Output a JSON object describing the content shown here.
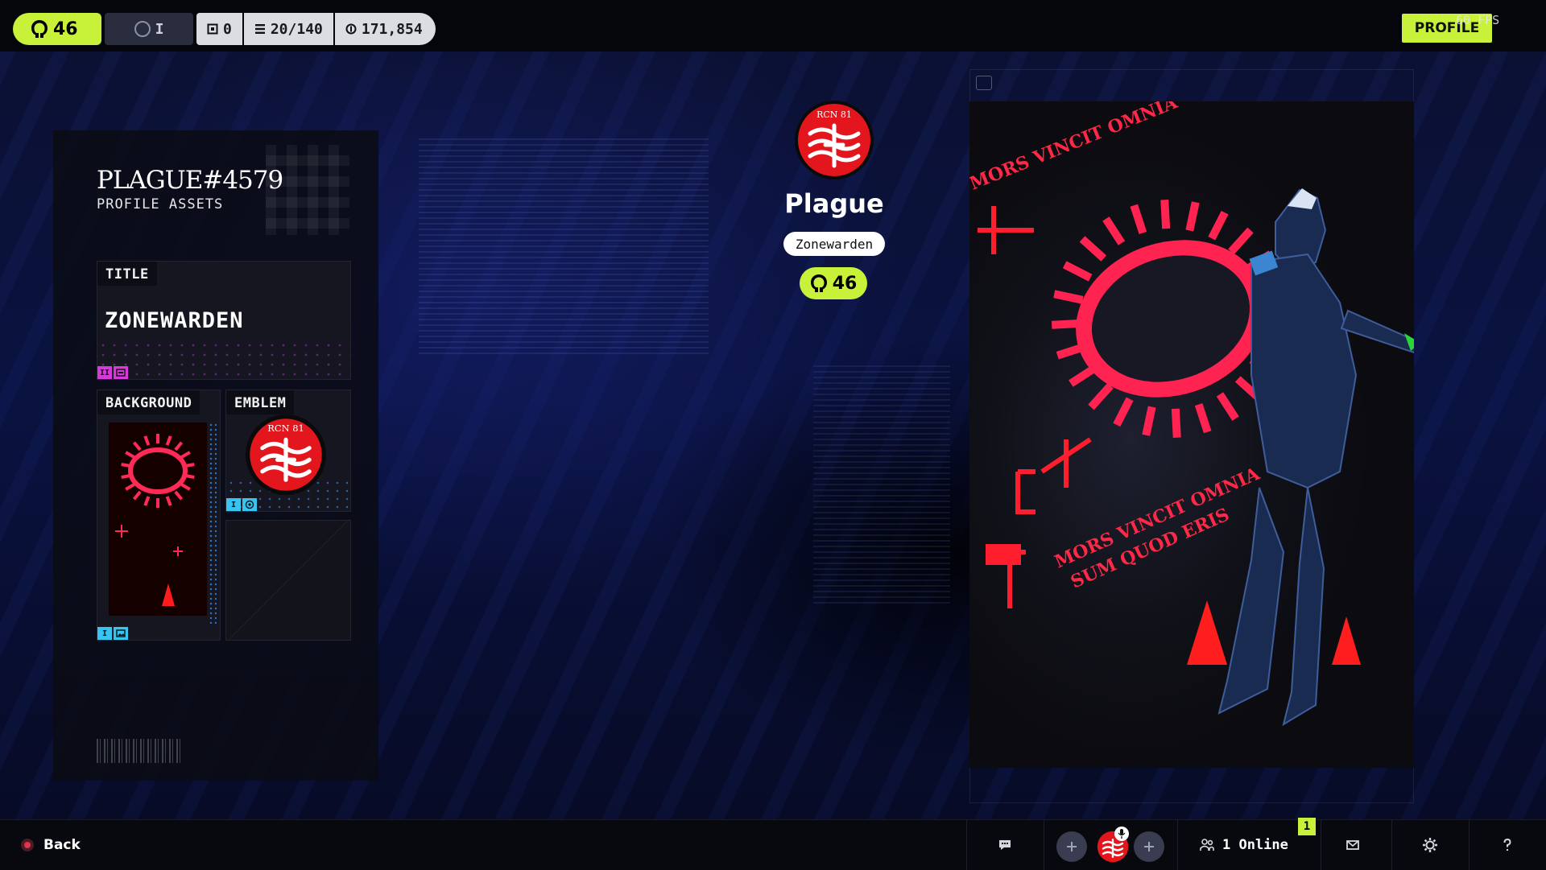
{
  "topbar": {
    "rank_level": "46",
    "level_roman": "I",
    "stat_squares": "0",
    "stat_progress": "20/140",
    "stat_currency": "171,854",
    "icons": [
      "rank-helmet-icon",
      "square-icon",
      "list-icon",
      "coin-icon"
    ]
  },
  "profile_button": "PROFILE",
  "fps": "60 FPS",
  "assets_panel": {
    "title": "PLAGUE#4579",
    "subtitle": "PROFILE ASSETS",
    "title_card": {
      "label": "TITLE",
      "value": "ZONEWARDEN",
      "tag_roman": "II"
    },
    "background_card": {
      "label": "BACKGROUND",
      "tag_roman": "I"
    },
    "emblem_card": {
      "label": "EMBLEM",
      "tag_roman": "I"
    }
  },
  "player": {
    "name": "Plague",
    "title": "Zonewarden",
    "level": "46",
    "emblem_text": "RCN 81"
  },
  "poster": {
    "text_lines": [
      "MORS VINCIT OMNIA",
      "SUM QUOD ERIS"
    ]
  },
  "bottombar": {
    "back_label": "Back",
    "online_label": "1 Online",
    "notification_count": "1"
  },
  "colors": {
    "accent": "#c8f23a",
    "emblem_red": "#e3161d",
    "tag_magenta": "#d63ad9",
    "tag_cyan": "#37c4f0",
    "panel": "#0b0c14"
  }
}
